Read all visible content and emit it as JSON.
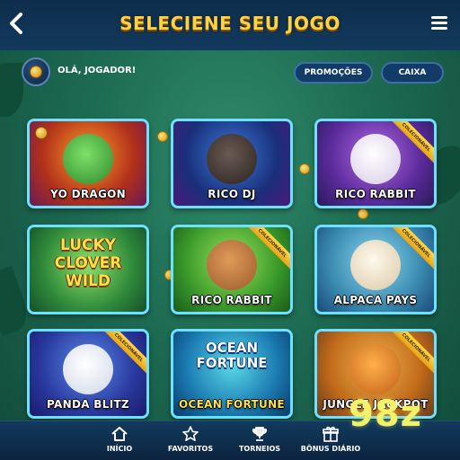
{
  "header": {
    "title": "SELECIENE SEU JOGO"
  },
  "user": {
    "greeting": "OLÁ, JOGADOR!"
  },
  "actions": {
    "promo_label": "PROMOÇÕES",
    "caixa_label": "CAIXA"
  },
  "ribbon_text": "COLECIONÁVEL",
  "games": [
    {
      "name": "YO DRAGON"
    },
    {
      "name": "RICO DJ"
    },
    {
      "name": "RICO RABBIT"
    },
    {
      "name": "LUCKY CLOVER WILD"
    },
    {
      "name": "RICO RABBIT"
    },
    {
      "name": "ALPACA PAYS"
    },
    {
      "name": "PANDA BLITZ"
    },
    {
      "name": "OCEAN FORTUNE",
      "banner": "OCEAN FORTUNE"
    },
    {
      "name": "JUNGLE JACKPOT"
    }
  ],
  "lucky_banner": {
    "line1": "LUCKY",
    "line2": "CLOVER",
    "line3": "WILD"
  },
  "nav": [
    {
      "label": "INÍCIO",
      "icon": "home-icon"
    },
    {
      "label": "FAVORITOS",
      "icon": "star-icon"
    },
    {
      "label": "TORNEIOS",
      "icon": "trophy-icon"
    },
    {
      "label": "BÔNUS DIÁRIO",
      "icon": "gift-icon"
    }
  ],
  "brand": "98z",
  "colors": {
    "title": "#ffd23f",
    "card_border": "#6fe0ff",
    "brand": "#f2f26a"
  }
}
